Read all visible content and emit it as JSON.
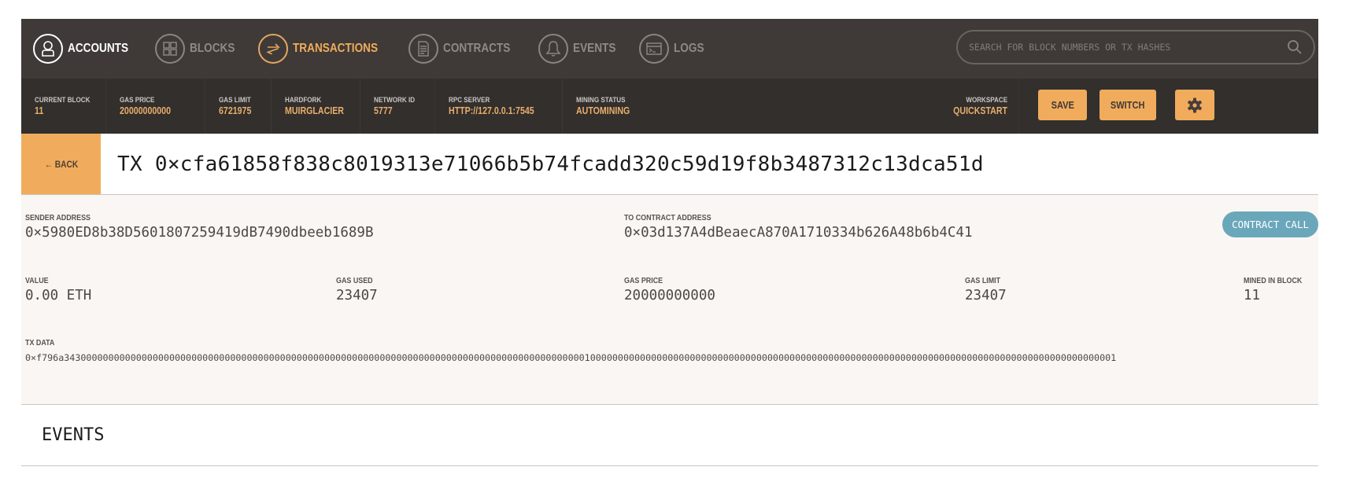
{
  "nav": {
    "items": [
      {
        "label": "ACCOUNTS",
        "icon": "person-icon",
        "state": "default-white"
      },
      {
        "label": "BLOCKS",
        "icon": "blocks-grid-icon",
        "state": "default"
      },
      {
        "label": "TRANSACTIONS",
        "icon": "swap-arrows-icon",
        "state": "active"
      },
      {
        "label": "CONTRACTS",
        "icon": "document-icon",
        "state": "default"
      },
      {
        "label": "EVENTS",
        "icon": "bell-icon",
        "state": "default"
      },
      {
        "label": "LOGS",
        "icon": "terminal-window-icon",
        "state": "default"
      }
    ],
    "search_placeholder": "SEARCH FOR BLOCK NUMBERS OR TX HASHES"
  },
  "status": {
    "current_block": {
      "label": "CURRENT BLOCK",
      "value": "11"
    },
    "gas_price": {
      "label": "GAS PRICE",
      "value": "20000000000"
    },
    "gas_limit": {
      "label": "GAS LIMIT",
      "value": "6721975"
    },
    "hardfork": {
      "label": "HARDFORK",
      "value": "MUIRGLACIER"
    },
    "network_id": {
      "label": "NETWORK ID",
      "value": "5777"
    },
    "rpc_server": {
      "label": "RPC SERVER",
      "value": "HTTP://127.0.0.1:7545"
    },
    "mining_status": {
      "label": "MINING STATUS",
      "value": "AUTOMINING"
    },
    "workspace": {
      "label": "WORKSPACE",
      "value": "QUICKSTART"
    },
    "save_label": "SAVE",
    "switch_label": "SWITCH"
  },
  "colors": {
    "accent": "#f0ac5c",
    "nav_bg": "#3f3a37",
    "status_bg": "#322f2d",
    "badge": "#6aa7bb",
    "details_bg": "#f9f6f3"
  },
  "page": {
    "back_label": "← BACK",
    "title": "TX 0×cfa61858f838c8019313e71066b5b74fcadd320c59d19f8b3487312c13dca51d"
  },
  "tx": {
    "sender": {
      "label": "SENDER ADDRESS",
      "value": "0×5980ED8b38D5601807259419dB7490dbeeb1689B"
    },
    "to": {
      "label": "TO CONTRACT ADDRESS",
      "value": "0×03d137A4dBeaecA870A1710334b626A48b6b4C41"
    },
    "type_badge": "CONTRACT CALL",
    "value": {
      "label": "VALUE",
      "value": "0.00 ETH"
    },
    "gas_used": {
      "label": "GAS USED",
      "value": "23407"
    },
    "gas_price": {
      "label": "GAS PRICE",
      "value": "20000000000"
    },
    "gas_limit": {
      "label": "GAS LIMIT",
      "value": "23407"
    },
    "mined_in_block": {
      "label": "MINED IN BLOCK",
      "value": "11"
    },
    "tx_data": {
      "label": "TX DATA",
      "value": "0×f796a3430000000000000000000000000000000000000000000000000000000000000000000000000000000000000000000100000000000000000000000000000000000000000000000000000000000000000000000000000000000000000000001"
    }
  },
  "events": {
    "heading": "EVENTS"
  }
}
